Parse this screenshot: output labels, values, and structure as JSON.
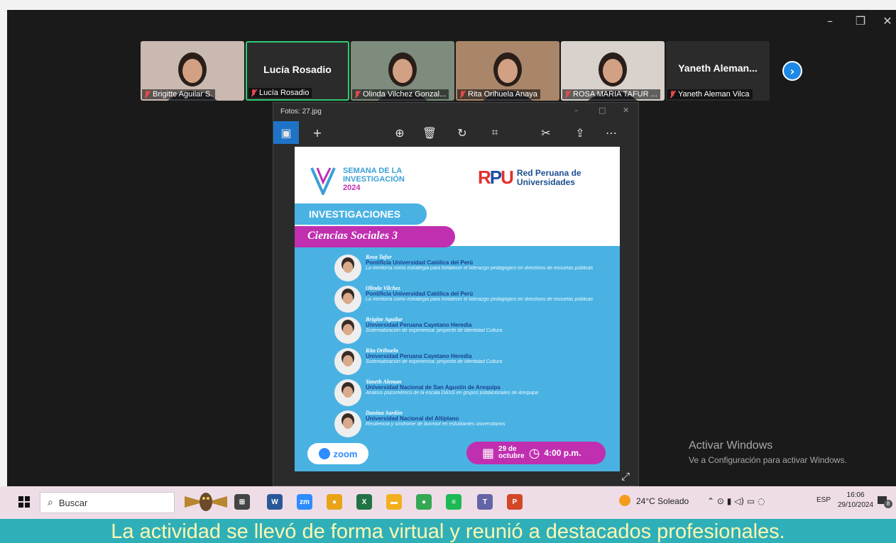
{
  "zoom": {
    "participants": [
      {
        "name": "Brigitte Aguilar S.",
        "video": true,
        "active": false,
        "bg": "#c9b9b1"
      },
      {
        "name": "Lucía Rosadio",
        "video": false,
        "active": true,
        "big_label": "Lucía Rosadio"
      },
      {
        "name": "Olinda Vilchez Gonzal...",
        "video": true,
        "active": false,
        "bg": "#7d8c7c"
      },
      {
        "name": "Rita Orihuela Anaya",
        "video": true,
        "active": false,
        "bg": "#a9866a"
      },
      {
        "name": "ROSA MARIA TAFUR ...",
        "video": true,
        "active": false,
        "bg": "#d8d1cc"
      },
      {
        "name": "Yaneth Aleman Vilca",
        "video": false,
        "active": false,
        "big_label": "Yaneth Aleman..."
      }
    ],
    "next_icon": "chevron-right-icon",
    "window_controls": {
      "minimize": "–",
      "restore": "❐",
      "close": "✕"
    }
  },
  "photos": {
    "title": "Fotos: 27.jpg",
    "toolbar": [
      {
        "name": "image-icon",
        "glyph": "▣"
      },
      {
        "name": "add-icon",
        "glyph": "+"
      },
      {
        "name": "zoom-in-icon",
        "glyph": "⊕"
      },
      {
        "name": "delete-icon",
        "glyph": "🗑"
      },
      {
        "name": "rotate-icon",
        "glyph": "↻"
      },
      {
        "name": "crop-icon",
        "glyph": "⌗"
      },
      {
        "name": "edit-icon",
        "glyph": "✂"
      },
      {
        "name": "share-icon",
        "glyph": "⇪"
      },
      {
        "name": "more-icon",
        "glyph": "⋯"
      }
    ],
    "poster": {
      "sem_line1": "SEMANA DE LA",
      "sem_line2": "INVESTIGACIÓN",
      "sem_year": "2024",
      "rpu_mark": "RPU",
      "rpu_line1": "Red Peruana de",
      "rpu_line2": "Universidades",
      "investigaciones": "INVESTIGACIONES",
      "area": "Ciencias Sociales 3",
      "speakers": [
        {
          "name": "Rosa Tafur",
          "university": "Pontificia Universidad Católica del Perú",
          "topic": "La mentoría como estrategia para fortalecer el liderazgo pedagógico en directivos de escuelas públicas"
        },
        {
          "name": "Olinda Vilchez",
          "university": "Pontificia Universidad Católica del Perú",
          "topic": "La mentoría como estrategia para fortalecer el liderazgo pedagógico en directivos de escuelas públicas"
        },
        {
          "name": "Brigitte Aguilar",
          "university": "Universidad Peruana Cayetano Heredia",
          "topic": "Sistematización de experiencia: proyecto de Identidad Cultura"
        },
        {
          "name": "Rita Orihuela",
          "university": "Universidad Peruana Cayetano Heredia",
          "topic": "Sistematización de experiencia: proyecto de Identidad Cultura"
        },
        {
          "name": "Yaneth Aleman",
          "university": "Universidad Nacional de San Agustín de Arequipa",
          "topic": "Análisis psicométrico de la escala DASS en grupos poblacionales de Arequipa"
        },
        {
          "name": "Danitza Sardón",
          "university": "Universidad Nacional del Altiplano",
          "topic": "Resiliencia y síndrome de burnout en estudiantes universitarios"
        }
      ],
      "zoom_label": "zoom",
      "date_day": "29 de",
      "date_month": "octubre",
      "time": "4:00 p.m."
    }
  },
  "activate_windows": {
    "title": "Activar Windows",
    "subtitle": "Ve a Configuración para activar Windows."
  },
  "taskbar": {
    "search_placeholder": "Buscar",
    "apps": [
      {
        "name": "task-view-icon",
        "label": "⊞",
        "color": "#444"
      },
      {
        "name": "word-icon",
        "label": "W",
        "color": "#2b579a"
      },
      {
        "name": "zoom-app-icon",
        "label": "zm",
        "color": "#2d8cff"
      },
      {
        "name": "chrome-icon",
        "label": "●",
        "color": "#e8a317"
      },
      {
        "name": "excel-icon",
        "label": "X",
        "color": "#217346"
      },
      {
        "name": "file-explorer-icon",
        "label": "▬",
        "color": "#f2b01e"
      },
      {
        "name": "chrome-profile-icon",
        "label": "●",
        "color": "#34a853"
      },
      {
        "name": "spotify-icon",
        "label": "≡",
        "color": "#1db954"
      },
      {
        "name": "teams-icon",
        "label": "T",
        "color": "#6264a7"
      },
      {
        "name": "powerpoint-icon",
        "label": "P",
        "color": "#d24726"
      }
    ],
    "weather": "24°C Soleado",
    "language": "ESP",
    "time": "16:06",
    "date": "29/10/2024",
    "notifications": "8"
  },
  "caption": "La actividad se llevó de forma virtual y reunió a destacados profesionales."
}
